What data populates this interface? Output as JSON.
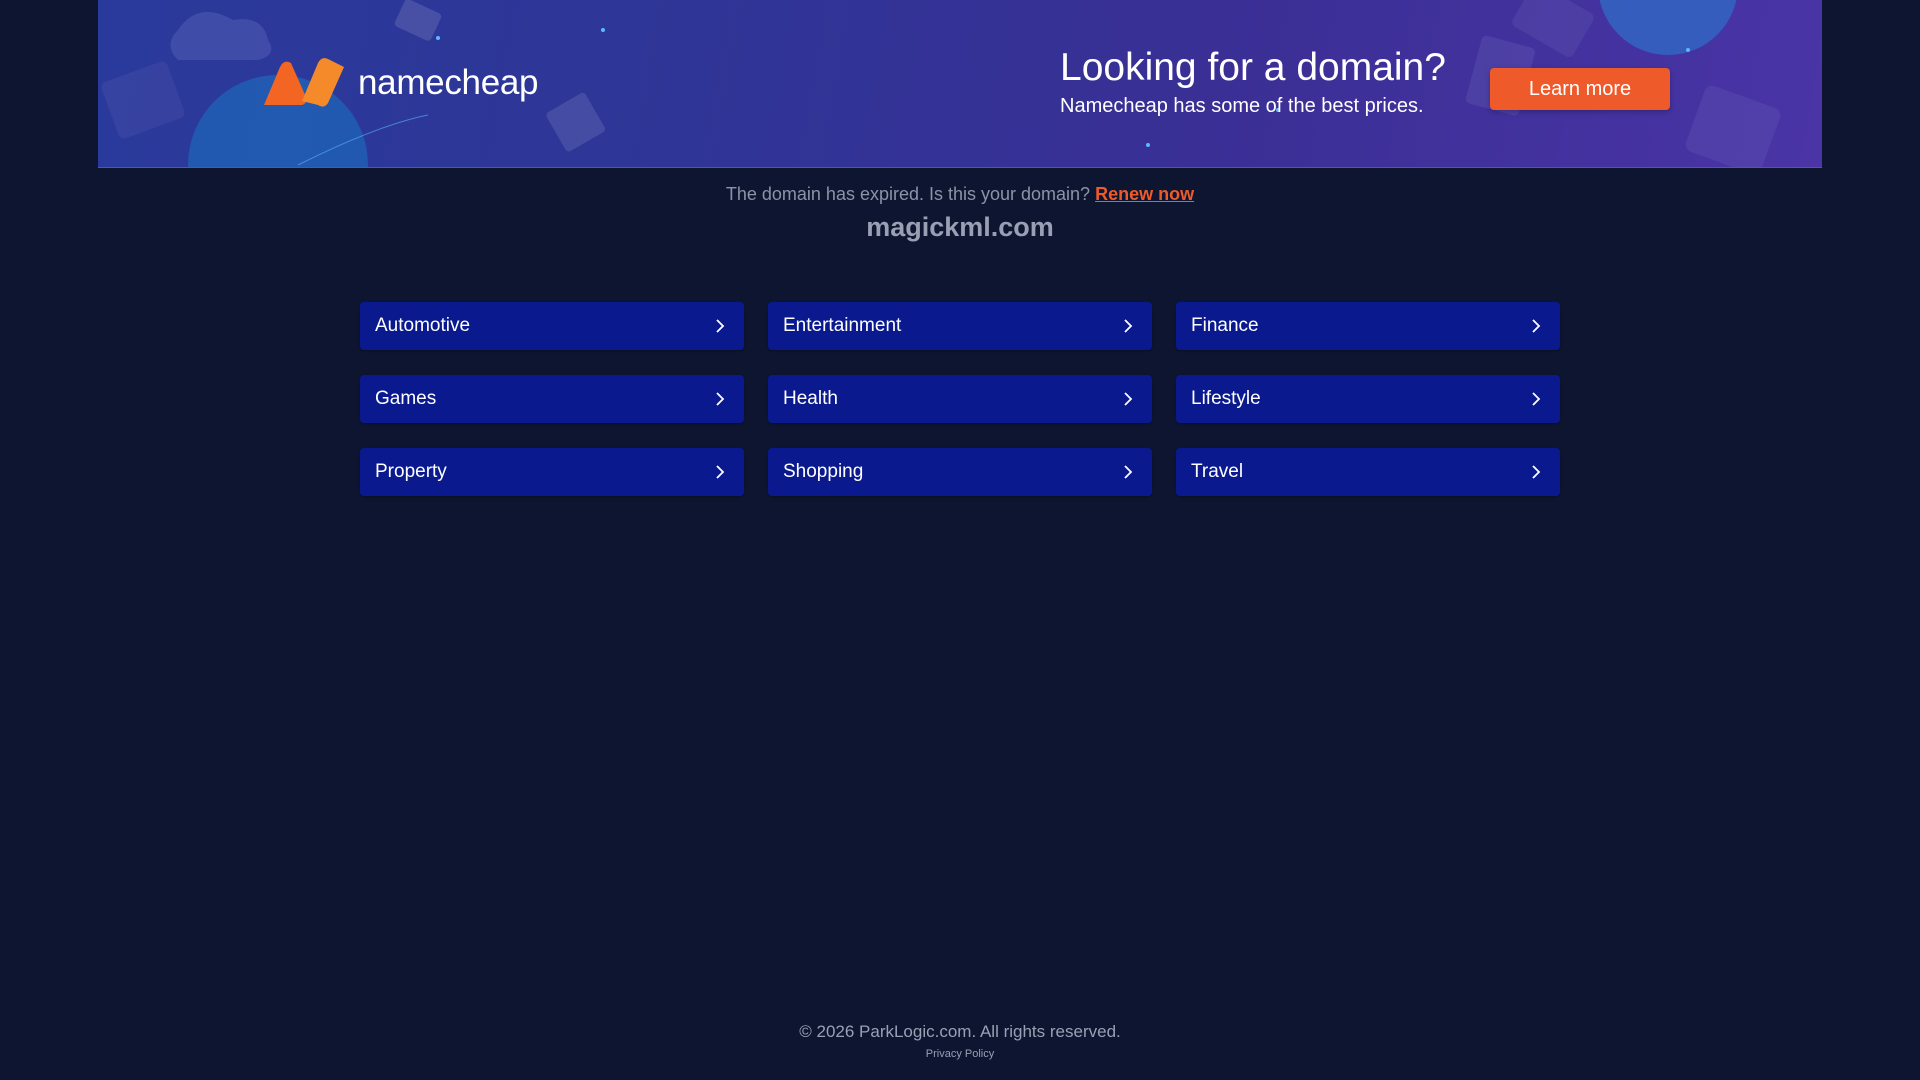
{
  "banner": {
    "logo_text": "namecheap",
    "title": "Looking for a domain?",
    "subtitle": "Namecheap has some of the best prices.",
    "cta_label": "Learn more",
    "colors": {
      "background_start": "#2a3a9c",
      "background_end": "#4a34a6",
      "accent": "#ee5a2a",
      "logo_orange": "#f26522"
    }
  },
  "notice": {
    "text": "The domain has expired. Is this your domain?",
    "link_label": "Renew now"
  },
  "domain": "magickml.com",
  "categories": [
    {
      "label": "Automotive",
      "icon": "chevron-right-icon"
    },
    {
      "label": "Entertainment",
      "icon": "chevron-right-icon"
    },
    {
      "label": "Finance",
      "icon": "chevron-right-icon"
    },
    {
      "label": "Games",
      "icon": "chevron-right-icon"
    },
    {
      "label": "Health",
      "icon": "chevron-right-icon"
    },
    {
      "label": "Lifestyle",
      "icon": "chevron-right-icon"
    },
    {
      "label": "Property",
      "icon": "chevron-right-icon"
    },
    {
      "label": "Shopping",
      "icon": "chevron-right-icon"
    },
    {
      "label": "Travel",
      "icon": "chevron-right-icon"
    }
  ],
  "footer": {
    "copyright": "© 2026 ParkLogic.com. All rights reserved.",
    "privacy_label": "Privacy Policy"
  },
  "colors": {
    "page_background": "#0d1530",
    "category_button": "#0a1a8e",
    "muted_text": "#8d93a6"
  }
}
